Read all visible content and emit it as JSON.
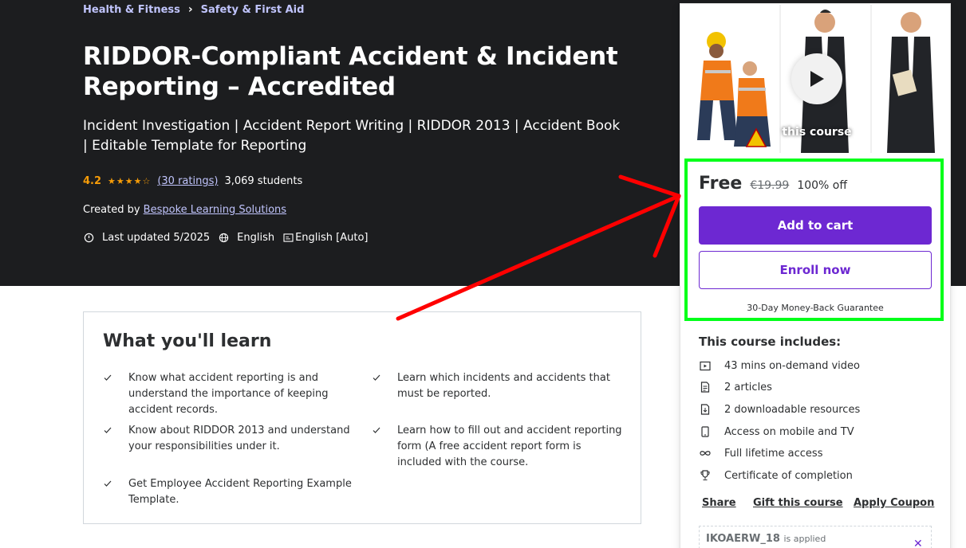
{
  "breadcrumb": {
    "item1": "Health & Fitness",
    "item2": "Safety & First Aid"
  },
  "course": {
    "title": "RIDDOR-Compliant Accident & Incident Reporting – Accredited",
    "subtitle": "Incident Investigation | Accident Report Writing | RIDDOR 2013 | Accident Book | Editable Template for Reporting",
    "rating": "4.2",
    "rating_fraction": 0.84,
    "ratings_count": "(30 ratings)",
    "students": "3,069 students",
    "created_by_label": "Created by",
    "author": "Bespoke Learning Solutions",
    "last_updated": "Last updated 5/2025",
    "language": "English",
    "captions": "English [Auto]"
  },
  "learn": {
    "title": "What you'll learn",
    "items": [
      "Know what accident reporting is and understand the importance of keeping accident records.",
      "Learn which incidents and accidents that must be reported.",
      "Know about RIDDOR 2013 and understand your responsibilities under it.",
      "Learn how to fill out and accident reporting form (A free accident report form is included with the course.",
      "Get Employee Accident Reporting Example Template."
    ]
  },
  "sidebar": {
    "preview_label": "this course",
    "price": "Free",
    "original_price": "€19.99",
    "discount": "100% off",
    "add_to_cart": "Add to cart",
    "enroll_now": "Enroll now",
    "guarantee": "30-Day Money-Back Guarantee",
    "includes_title": "This course includes:",
    "includes": [
      {
        "icon": "video-icon",
        "text": "43 mins on-demand video"
      },
      {
        "icon": "article-icon",
        "text": "2 articles"
      },
      {
        "icon": "download-icon",
        "text": "2 downloadable resources"
      },
      {
        "icon": "mobile-icon",
        "text": "Access on mobile and TV"
      },
      {
        "icon": "infinity-icon",
        "text": "Full lifetime access"
      },
      {
        "icon": "trophy-icon",
        "text": "Certificate of completion"
      }
    ],
    "share": "Share",
    "gift": "Gift this course",
    "apply_coupon": "Apply Coupon",
    "coupon_code": "IKOAERW_18",
    "coupon_applied": "is applied"
  },
  "colors": {
    "hero_bg": "#1c1d1f",
    "accent": "#6d28d2",
    "link": "#c0c4fc",
    "star": "#f69c08",
    "highlight_box": "#00ff19",
    "annotation_arrow": "#ff0000"
  }
}
